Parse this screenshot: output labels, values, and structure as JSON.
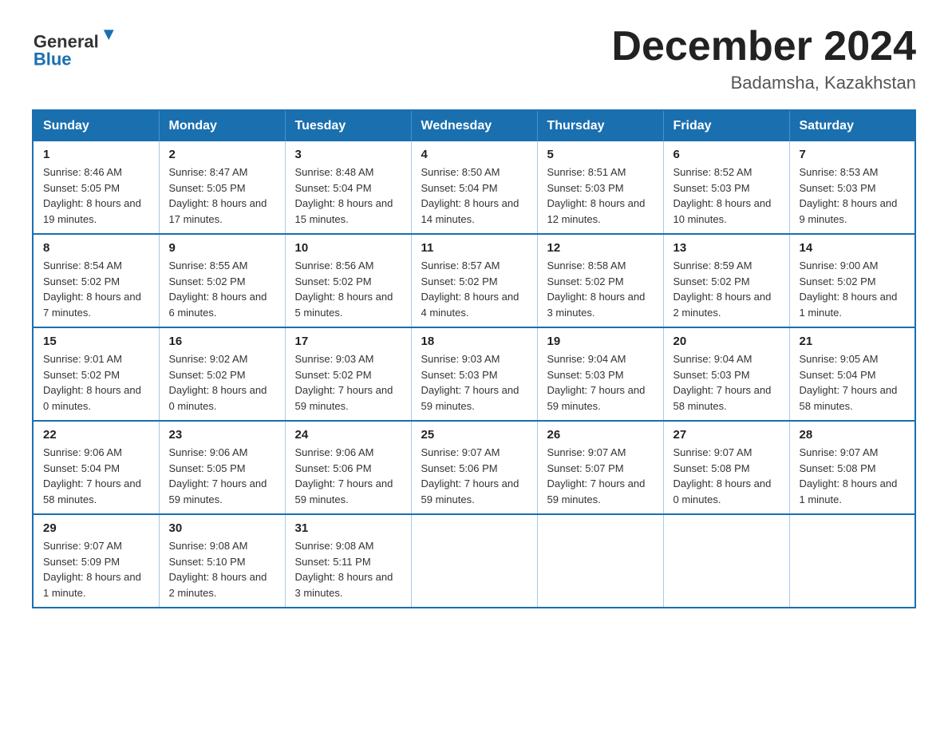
{
  "logo": {
    "general": "General",
    "blue": "Blue",
    "arrow_color": "#1a6faf"
  },
  "header": {
    "title": "December 2024",
    "subtitle": "Badamsha, Kazakhstan"
  },
  "weekdays": [
    "Sunday",
    "Monday",
    "Tuesday",
    "Wednesday",
    "Thursday",
    "Friday",
    "Saturday"
  ],
  "weeks": [
    [
      {
        "day": "1",
        "sunrise": "8:46 AM",
        "sunset": "5:05 PM",
        "daylight": "8 hours and 19 minutes."
      },
      {
        "day": "2",
        "sunrise": "8:47 AM",
        "sunset": "5:05 PM",
        "daylight": "8 hours and 17 minutes."
      },
      {
        "day": "3",
        "sunrise": "8:48 AM",
        "sunset": "5:04 PM",
        "daylight": "8 hours and 15 minutes."
      },
      {
        "day": "4",
        "sunrise": "8:50 AM",
        "sunset": "5:04 PM",
        "daylight": "8 hours and 14 minutes."
      },
      {
        "day": "5",
        "sunrise": "8:51 AM",
        "sunset": "5:03 PM",
        "daylight": "8 hours and 12 minutes."
      },
      {
        "day": "6",
        "sunrise": "8:52 AM",
        "sunset": "5:03 PM",
        "daylight": "8 hours and 10 minutes."
      },
      {
        "day": "7",
        "sunrise": "8:53 AM",
        "sunset": "5:03 PM",
        "daylight": "8 hours and 9 minutes."
      }
    ],
    [
      {
        "day": "8",
        "sunrise": "8:54 AM",
        "sunset": "5:02 PM",
        "daylight": "8 hours and 7 minutes."
      },
      {
        "day": "9",
        "sunrise": "8:55 AM",
        "sunset": "5:02 PM",
        "daylight": "8 hours and 6 minutes."
      },
      {
        "day": "10",
        "sunrise": "8:56 AM",
        "sunset": "5:02 PM",
        "daylight": "8 hours and 5 minutes."
      },
      {
        "day": "11",
        "sunrise": "8:57 AM",
        "sunset": "5:02 PM",
        "daylight": "8 hours and 4 minutes."
      },
      {
        "day": "12",
        "sunrise": "8:58 AM",
        "sunset": "5:02 PM",
        "daylight": "8 hours and 3 minutes."
      },
      {
        "day": "13",
        "sunrise": "8:59 AM",
        "sunset": "5:02 PM",
        "daylight": "8 hours and 2 minutes."
      },
      {
        "day": "14",
        "sunrise": "9:00 AM",
        "sunset": "5:02 PM",
        "daylight": "8 hours and 1 minute."
      }
    ],
    [
      {
        "day": "15",
        "sunrise": "9:01 AM",
        "sunset": "5:02 PM",
        "daylight": "8 hours and 0 minutes."
      },
      {
        "day": "16",
        "sunrise": "9:02 AM",
        "sunset": "5:02 PM",
        "daylight": "8 hours and 0 minutes."
      },
      {
        "day": "17",
        "sunrise": "9:03 AM",
        "sunset": "5:02 PM",
        "daylight": "7 hours and 59 minutes."
      },
      {
        "day": "18",
        "sunrise": "9:03 AM",
        "sunset": "5:03 PM",
        "daylight": "7 hours and 59 minutes."
      },
      {
        "day": "19",
        "sunrise": "9:04 AM",
        "sunset": "5:03 PM",
        "daylight": "7 hours and 59 minutes."
      },
      {
        "day": "20",
        "sunrise": "9:04 AM",
        "sunset": "5:03 PM",
        "daylight": "7 hours and 58 minutes."
      },
      {
        "day": "21",
        "sunrise": "9:05 AM",
        "sunset": "5:04 PM",
        "daylight": "7 hours and 58 minutes."
      }
    ],
    [
      {
        "day": "22",
        "sunrise": "9:06 AM",
        "sunset": "5:04 PM",
        "daylight": "7 hours and 58 minutes."
      },
      {
        "day": "23",
        "sunrise": "9:06 AM",
        "sunset": "5:05 PM",
        "daylight": "7 hours and 59 minutes."
      },
      {
        "day": "24",
        "sunrise": "9:06 AM",
        "sunset": "5:06 PM",
        "daylight": "7 hours and 59 minutes."
      },
      {
        "day": "25",
        "sunrise": "9:07 AM",
        "sunset": "5:06 PM",
        "daylight": "7 hours and 59 minutes."
      },
      {
        "day": "26",
        "sunrise": "9:07 AM",
        "sunset": "5:07 PM",
        "daylight": "7 hours and 59 minutes."
      },
      {
        "day": "27",
        "sunrise": "9:07 AM",
        "sunset": "5:08 PM",
        "daylight": "8 hours and 0 minutes."
      },
      {
        "day": "28",
        "sunrise": "9:07 AM",
        "sunset": "5:08 PM",
        "daylight": "8 hours and 1 minute."
      }
    ],
    [
      {
        "day": "29",
        "sunrise": "9:07 AM",
        "sunset": "5:09 PM",
        "daylight": "8 hours and 1 minute."
      },
      {
        "day": "30",
        "sunrise": "9:08 AM",
        "sunset": "5:10 PM",
        "daylight": "8 hours and 2 minutes."
      },
      {
        "day": "31",
        "sunrise": "9:08 AM",
        "sunset": "5:11 PM",
        "daylight": "8 hours and 3 minutes."
      },
      null,
      null,
      null,
      null
    ]
  ]
}
